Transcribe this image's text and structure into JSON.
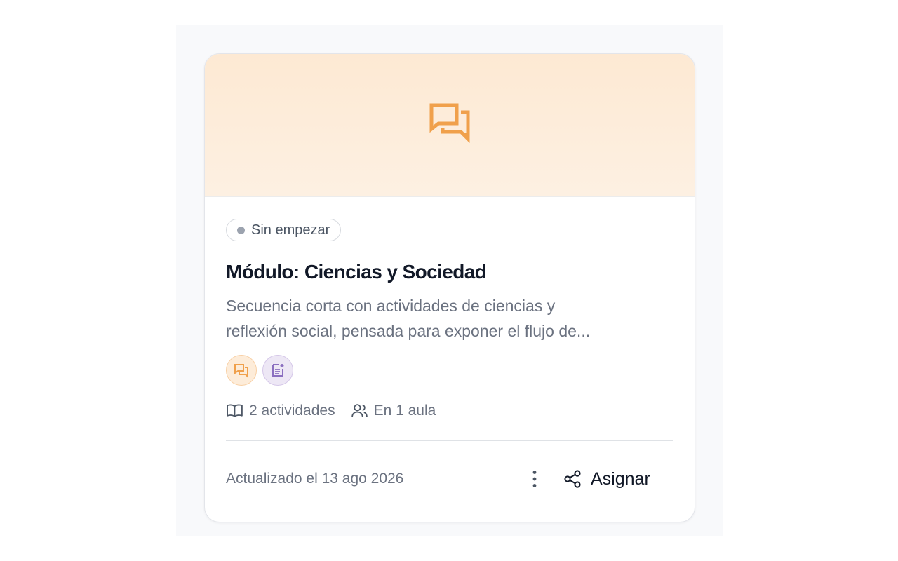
{
  "card": {
    "status": "Sin empezar",
    "title": "Módulo: Ciencias y Sociedad",
    "description_lines": [
      "Secuencia corta con actividades de ciencias y",
      "reflexión social, pensada para exponer el flujo de..."
    ],
    "activity_types": [
      "discussion-icon",
      "worksheet-icon"
    ],
    "meta": {
      "activities": "2 actividades",
      "classrooms": "En 1 aula"
    },
    "updated": "Actualizado el 13 ago 2026",
    "assign_label": "Asignar"
  },
  "colors": {
    "banner": "#fde9d3",
    "accent_orange": "#f0a04b",
    "accent_purple": "#8b6fc0",
    "status_dot": "#9ca3af"
  }
}
